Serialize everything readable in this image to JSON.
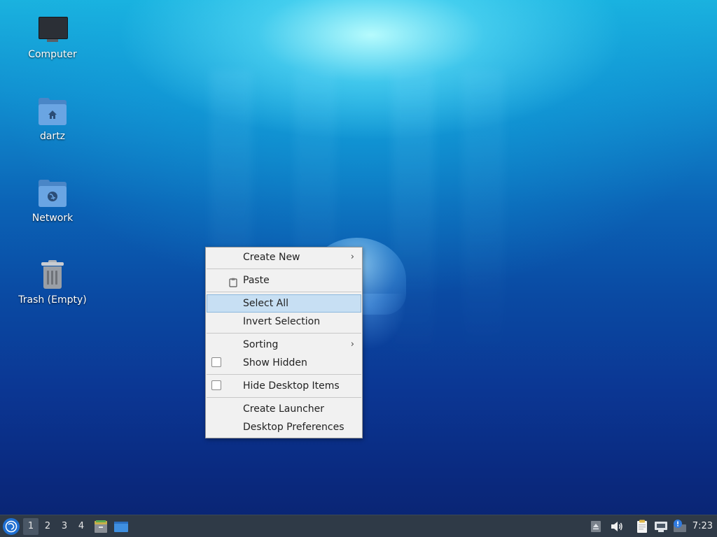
{
  "desktop": {
    "icons": [
      {
        "label": "Computer",
        "icon": "computer-icon"
      },
      {
        "label": "dartz",
        "icon": "home-folder-icon"
      },
      {
        "label": "Network",
        "icon": "network-folder-icon"
      },
      {
        "label": "Trash (Empty)",
        "icon": "trash-icon"
      }
    ]
  },
  "context_menu": {
    "items": [
      {
        "label": "Create New",
        "has_submenu": true
      },
      {
        "label": "Paste",
        "icon": "clipboard-icon"
      },
      {
        "label": "Select All",
        "highlighted": true
      },
      {
        "label": "Invert Selection"
      },
      {
        "label": "Sorting",
        "has_submenu": true
      },
      {
        "label": "Show Hidden",
        "checkbox": true,
        "checked": false
      },
      {
        "label": "Hide Desktop Items",
        "checkbox": true,
        "checked": false
      },
      {
        "label": "Create Launcher"
      },
      {
        "label": "Desktop Preferences"
      }
    ],
    "submenu_glyph": "›"
  },
  "taskbar": {
    "workspaces": [
      "1",
      "2",
      "3",
      "4"
    ],
    "active_workspace": "1",
    "clock": "7:23"
  },
  "colors": {
    "taskbar": "#2f3a47",
    "menu_bg": "#f1f1f1",
    "menu_highlight": "#c7dff3",
    "folder": "#6aa5e3"
  }
}
